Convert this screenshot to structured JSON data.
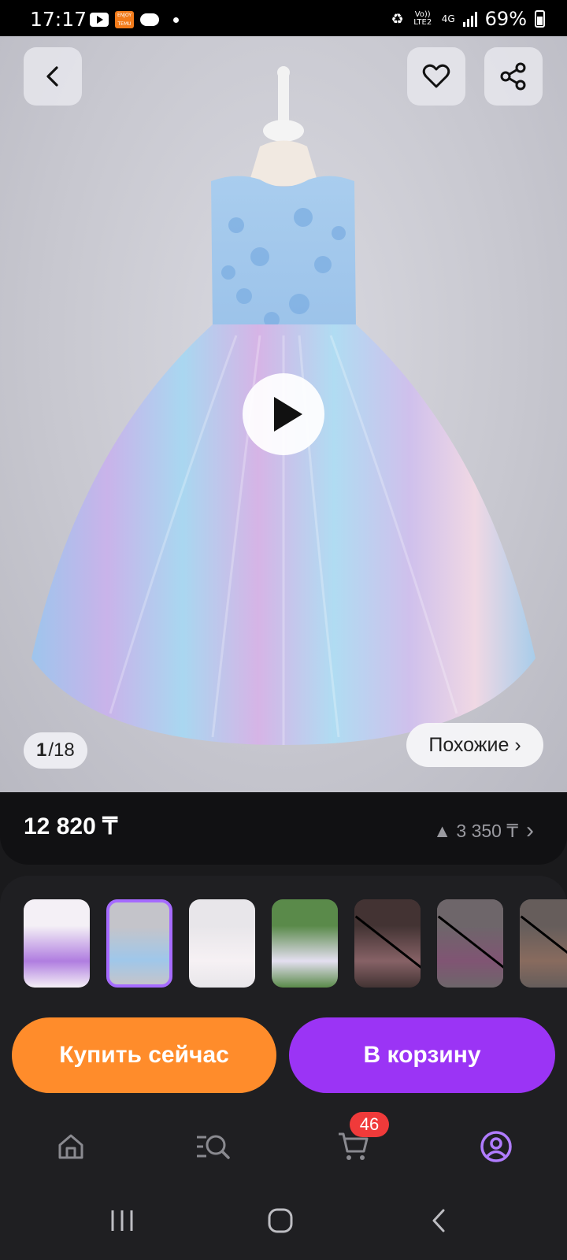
{
  "status_bar": {
    "time": "17:17",
    "temu_label": "ENJOY TEMU",
    "volte": "Vo)) LTE2",
    "network": "4G",
    "battery": "69%"
  },
  "hero": {
    "image_counter_current": "1",
    "image_counter_total": "/18",
    "similar_label": "Похожие ›"
  },
  "price": {
    "current": "12 820 ₸",
    "secondary": "▲ 3 350 ₸",
    "chevron": "›"
  },
  "thumbnails": [
    {
      "name": "purple-dress",
      "colors": [
        "#f4f0f6",
        "#b07de0"
      ],
      "selected": false,
      "out_of_stock": false
    },
    {
      "name": "rainbow-dress",
      "colors": [
        "#c4c4ca",
        "#9fc7ea"
      ],
      "selected": true,
      "out_of_stock": false
    },
    {
      "name": "unicorn-white-dress",
      "colors": [
        "#e8e6ea",
        "#f6f1f4"
      ],
      "selected": false,
      "out_of_stock": false
    },
    {
      "name": "unicorn-girl-garden",
      "colors": [
        "#5a8a4a",
        "#e4dff0"
      ],
      "selected": false,
      "out_of_stock": false
    },
    {
      "name": "pink-ruffle-dress",
      "colors": [
        "#6a4e4c",
        "#e5a2a8"
      ],
      "selected": false,
      "out_of_stock": true
    },
    {
      "name": "girl-pink-dress",
      "colors": [
        "#b8aab0",
        "#d98ac0"
      ],
      "selected": false,
      "out_of_stock": true
    },
    {
      "name": "peach-dress",
      "colors": [
        "#a99a94",
        "#e8b39a"
      ],
      "selected": false,
      "out_of_stock": true
    }
  ],
  "actions": {
    "buy_now": "Купить сейчас",
    "add_to_cart": "В корзину"
  },
  "tabbar": {
    "cart_badge": "46",
    "active_color": "#b07cff"
  },
  "colors": {
    "buy_button": "#ff8c2b",
    "cart_button": "#9b34f5",
    "badge": "#f03a3a"
  }
}
